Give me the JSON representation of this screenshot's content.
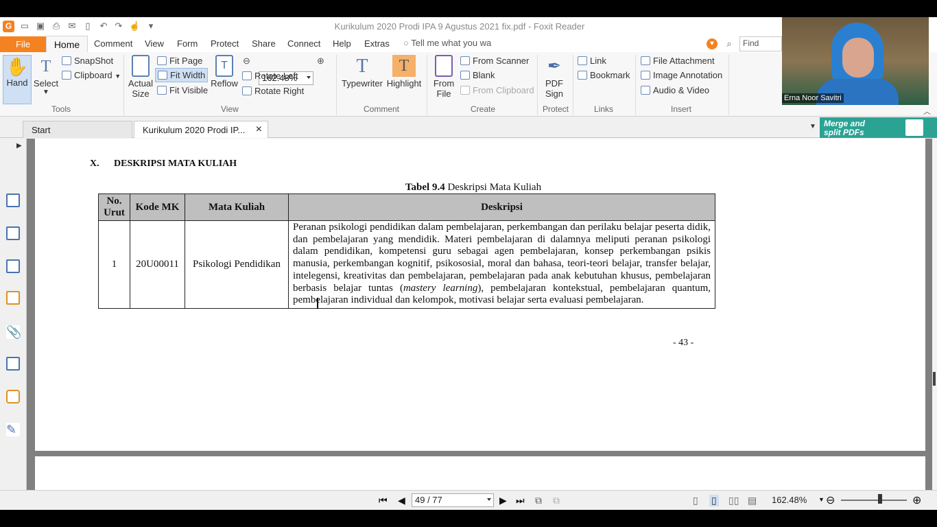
{
  "window": {
    "title": "Kurikulum 2020 Prodi IPA 9 Agustus 2021 fix.pdf - Foxit Reader"
  },
  "quick_access": [
    "foxit-logo",
    "open",
    "save",
    "print",
    "email",
    "new",
    "undo",
    "redo",
    "hand-tool",
    "customize"
  ],
  "menu": {
    "file": "File",
    "tabs": [
      "Home",
      "Comment",
      "View",
      "Form",
      "Protect",
      "Share",
      "Connect",
      "Help",
      "Extras"
    ],
    "tell_me": "Tell me what you wa",
    "find_placeholder": "Find"
  },
  "ribbon": {
    "tools": {
      "label": "Tools",
      "hand": "Hand",
      "select": "Select",
      "snapshot": "SnapShot",
      "clipboard": "Clipboard"
    },
    "view": {
      "label": "View",
      "actual_size_1": "Actual",
      "actual_size_2": "Size",
      "fit_page": "Fit Page",
      "fit_width": "Fit Width",
      "fit_visible": "Fit Visible",
      "reflow": "Reflow",
      "zoom": "162.48%",
      "rotate_left": "Rotate Left",
      "rotate_right": "Rotate Right"
    },
    "comment": {
      "label": "Comment",
      "typewriter": "Typewriter",
      "highlight": "Highlight"
    },
    "create": {
      "label": "Create",
      "from_file_1": "From",
      "from_file_2": "File",
      "from_scanner": "From Scanner",
      "blank": "Blank",
      "from_clipboard": "From Clipboard"
    },
    "protect": {
      "label": "Protect",
      "pdf_sign_1": "PDF",
      "pdf_sign_2": "Sign"
    },
    "links": {
      "label": "Links",
      "link": "Link",
      "bookmark": "Bookmark"
    },
    "insert": {
      "label": "Insert",
      "file_attachment": "File Attachment",
      "image_annotation": "Image Annotation",
      "audio_video": "Audio & Video"
    }
  },
  "doc_tabs": {
    "start": "Start",
    "active": "Kurikulum 2020 Prodi IP...",
    "close": "×"
  },
  "banner": {
    "line1": "Merge and",
    "line2": "split PDFs"
  },
  "video": {
    "name": "Erna Noor Savitri"
  },
  "document": {
    "section_num": "X.",
    "section_title": "DESKRIPSI MATA KULIAH",
    "caption_bold": "Tabel 9.4",
    "caption_rest": " Deskripsi Mata Kuliah",
    "table_headers": [
      "No. Urut",
      "Kode MK",
      "Mata Kuliah",
      "Deskripsi"
    ],
    "rows": [
      {
        "no": "1",
        "kode": "20U00011",
        "mata_kuliah": "Psikologi Pendidikan",
        "desc_a": "Peranan psikologi pendidikan dalam pembelajaran, perkembangan dan perilaku belajar peserta didik, dan pembelajaran yang mendidik. Materi pembelajaran di dalamnya meliputi peranan psikologi dalam pendidikan, kompetensi guru sebagai agen pembelajaran, konsep perkembangan psikis manusia, perkembangan kognitif, psikososial, moral dan bahasa, teori-teori belajar, transfer belajar, intelegensi, kreativitas dan pembelajaran, pembelajaran pada anak kebutuhan khusus, pembelajaran berbasis belajar tuntas (",
        "desc_italic": "mastery learning",
        "desc_b": "), pembelajaran kontekstual, pembelajaran quantum, pembelajaran individual dan kelompok, motivasi belajar serta evaluasi pembelajaran."
      }
    ],
    "page_number": "- 43 -"
  },
  "status": {
    "page": "49 / 77",
    "zoom": "162.48%"
  },
  "colors": {
    "accent": "#f58220",
    "banner": "#2aa394"
  }
}
